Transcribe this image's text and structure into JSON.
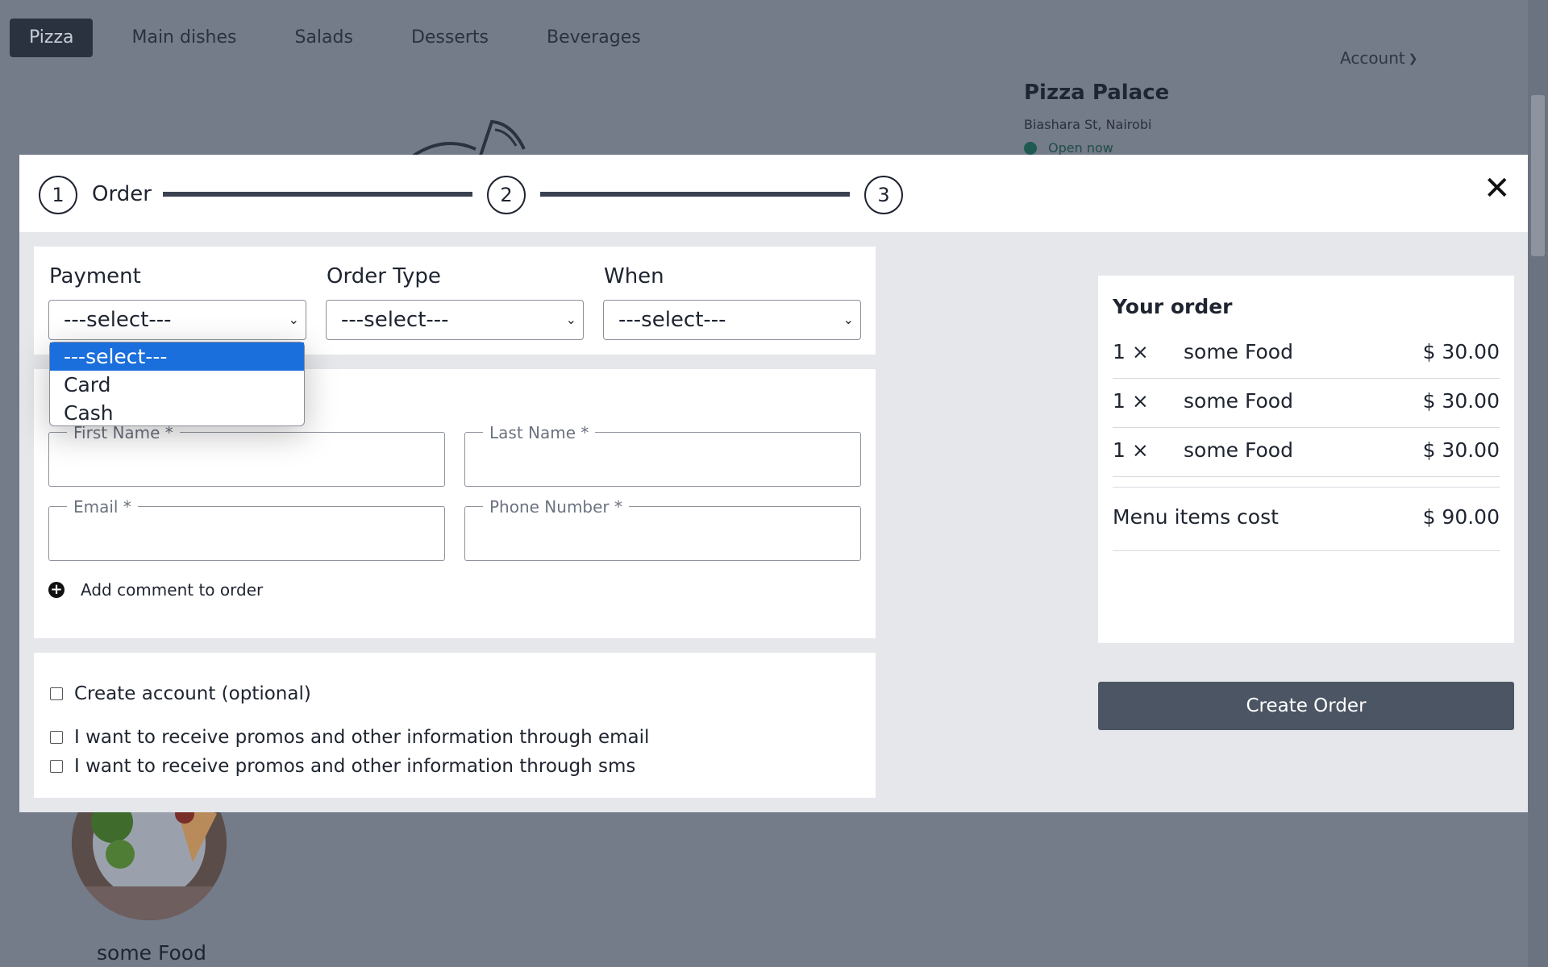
{
  "nav": {
    "tabs": [
      "Pizza",
      "Main dishes",
      "Salads",
      "Desserts",
      "Beverages"
    ],
    "account_label": "Account"
  },
  "restaurant": {
    "name": "Pizza Palace",
    "address": "Biashara St, Nairobi",
    "status": "Open now"
  },
  "background": {
    "food_caption": "some Food"
  },
  "modal": {
    "steps": [
      {
        "number": "1",
        "label": "Order"
      },
      {
        "number": "2"
      },
      {
        "number": "3"
      }
    ],
    "close_icon": "close-icon",
    "payment": {
      "label": "Payment",
      "value": "---select---",
      "options": [
        "---select---",
        "Card",
        "Cash"
      ],
      "highlighted": "---select---"
    },
    "order_type": {
      "label": "Order Type",
      "value": "---select---"
    },
    "when": {
      "label": "When",
      "value": "---select---"
    },
    "fields": {
      "first_name": "First Name *",
      "last_name": "Last Name *",
      "email": "Email *",
      "phone": "Phone Number *"
    },
    "add_comment": "Add comment to order",
    "checkboxes": {
      "create_account": "Create account (optional)",
      "promo_email": "I want to receive promos and other information through email",
      "promo_sms": "I want to receive promos and other information through sms"
    },
    "order_summary": {
      "title": "Your order",
      "items": [
        {
          "qty": "1 ×",
          "name": "some Food",
          "price": "$ 30.00"
        },
        {
          "qty": "1 ×",
          "name": "some Food",
          "price": "$ 30.00"
        },
        {
          "qty": "1 ×",
          "name": "some Food",
          "price": "$ 30.00"
        }
      ],
      "total_label": "Menu items cost",
      "total_value": "$ 90.00"
    },
    "create_order_label": "Create Order"
  },
  "colors": {
    "overlay": "#747b89",
    "select_highlight": "#1a6fdc",
    "primary_button": "#4b5563"
  }
}
